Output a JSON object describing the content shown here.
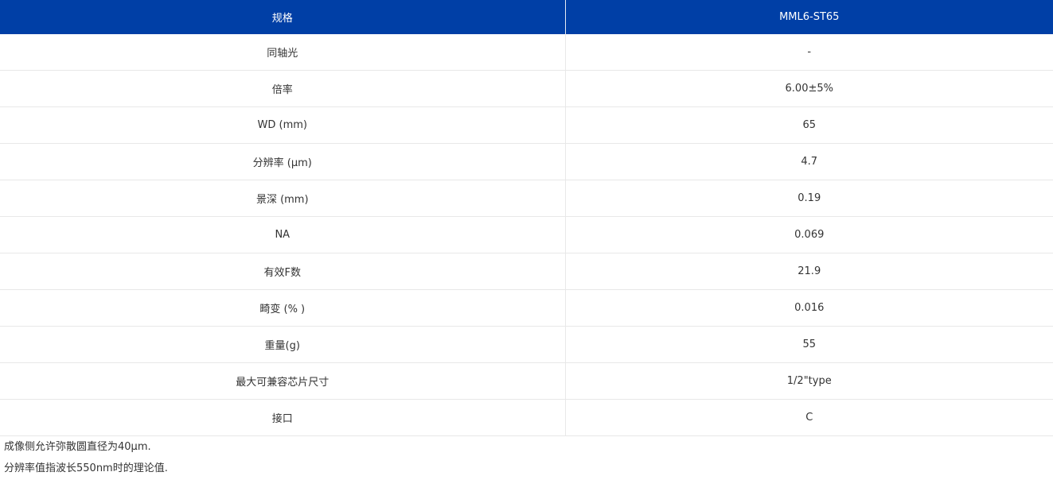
{
  "table": {
    "header": {
      "key": "规格",
      "value": "MML6-ST65"
    },
    "rows": [
      {
        "key": "同轴光",
        "value": "-"
      },
      {
        "key": "倍率",
        "value": "6.00±5%"
      },
      {
        "key": "WD (mm)",
        "value": "65"
      },
      {
        "key": "分辨率 (μm)",
        "value": "4.7"
      },
      {
        "key": "景深 (mm)",
        "value": "0.19"
      },
      {
        "key": "NA",
        "value": "0.069"
      },
      {
        "key": "有效F数",
        "value": "21.9"
      },
      {
        "key": "畸变 (% )",
        "value": "0.016"
      },
      {
        "key": "重量(g)",
        "value": "55"
      },
      {
        "key": "最大可兼容芯片尺寸",
        "value": "1/2\"type"
      },
      {
        "key": "接口",
        "value": "C"
      }
    ]
  },
  "notes": [
    "成像侧允许弥散圆直径为40μm.",
    "分辨率值指波长550nm时的理论值."
  ],
  "colors": {
    "header_bg": "#003fa6",
    "header_text": "#ffffff",
    "border": "#e8e8e8"
  }
}
